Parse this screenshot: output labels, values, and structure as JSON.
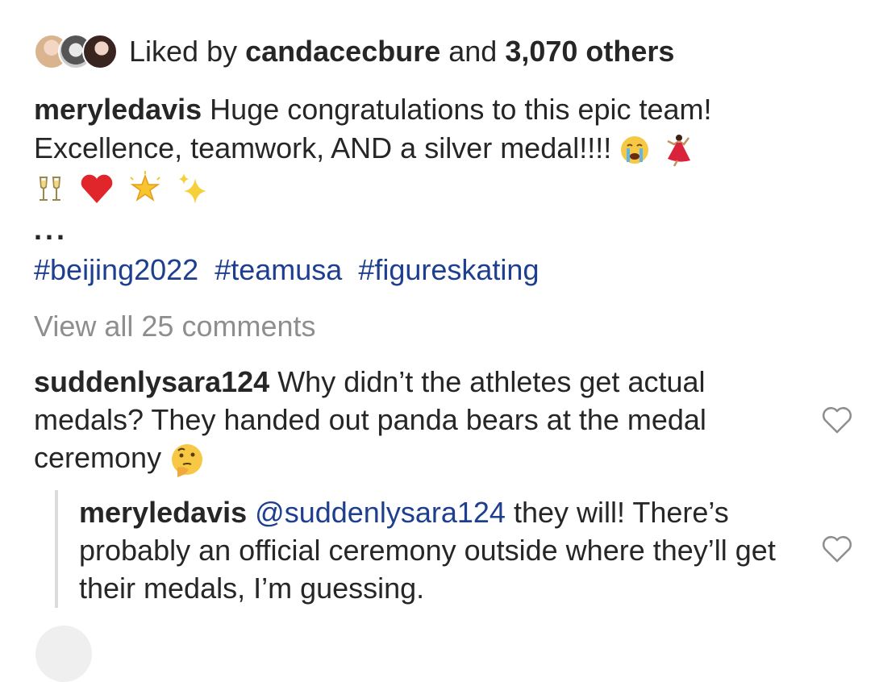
{
  "likes": {
    "prefix": "Liked by",
    "user": "candacecbure",
    "middle": "and",
    "count": "3,070 others"
  },
  "post": {
    "username": "meryledavis",
    "caption": "Huge congratulations to this epic team! Excellence, teamwork, AND a silver medal!!!!",
    "more": "...",
    "hashtags": [
      "#beijing2022",
      "#teamusa",
      "#figureskating"
    ]
  },
  "view_all": "View all 25 comments",
  "comments": [
    {
      "username": "suddenlysara124",
      "text": "Why didn’t the athletes get actual medals? They handed out panda bears at the medal ceremony"
    }
  ],
  "replies": [
    {
      "username": "meryledavis",
      "mention": "@suddenlysara124",
      "text": "they will! There’s probably an official ceremony outside where they’ll get their medals, I’m guessing."
    }
  ],
  "icons": {
    "crying": "crying-face-emoji",
    "dancer": "dancer-emoji",
    "champagne": "champagne-glasses-emoji",
    "heart": "red-heart-emoji",
    "star": "glowing-star-emoji",
    "sparkles": "sparkles-emoji",
    "thinking": "thinking-face-emoji",
    "like": "heart-outline-icon"
  }
}
